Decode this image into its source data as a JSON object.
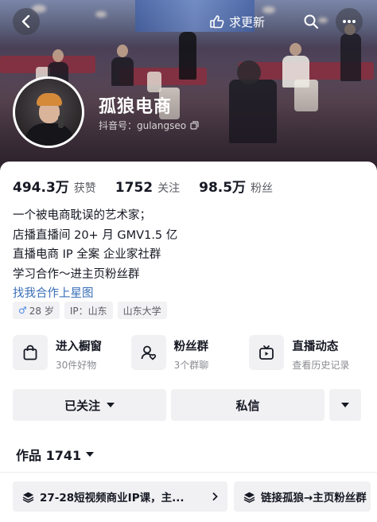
{
  "header": {
    "update_label": "求更新"
  },
  "profile": {
    "name": "孤狼电商",
    "douyin_id": "抖音号：gulangseo"
  },
  "stats": [
    {
      "value": "494.3万",
      "label": "获赞"
    },
    {
      "value": "1752",
      "label": "关注"
    },
    {
      "value": "98.5万",
      "label": "粉丝"
    }
  ],
  "bio": {
    "lines": [
      "一个被电商耽误的艺术家；",
      "店播直播间 20+ 月 GMV1.5 亿",
      "直播电商 IP 全案  企业家社群",
      "学习合作～进主页粉丝群"
    ],
    "link": "找我合作上星图"
  },
  "tags": [
    {
      "icon": "male-icon",
      "text": "28 岁"
    },
    {
      "text": "IP：山东"
    },
    {
      "text": "山东大学"
    }
  ],
  "features": [
    {
      "icon": "shopping-bag-icon",
      "title": "进入橱窗",
      "subtitle": "30件好物"
    },
    {
      "icon": "fan-group-icon",
      "title": "粉丝群",
      "subtitle": "3个群聊"
    },
    {
      "icon": "live-tv-icon",
      "title": "直播动态",
      "subtitle": "查看历史记录"
    }
  ],
  "actions": {
    "follow_label": "已关注",
    "message_label": "私信"
  },
  "works": {
    "label": "作品 1741"
  },
  "collections": [
    {
      "label": "27-28短视频商业IP课，主..."
    },
    {
      "label": "链接孤狼→主页粉丝群"
    }
  ]
}
